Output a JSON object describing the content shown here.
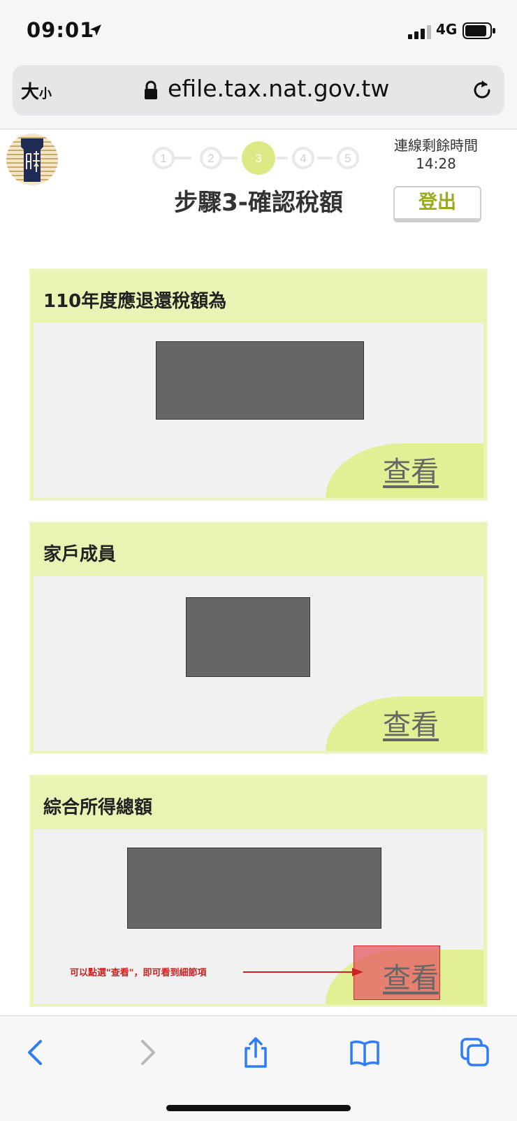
{
  "status_bar": {
    "time": "09:01",
    "network": "4G",
    "location_icon": "location-arrow-icon",
    "signal_icon": "signal-bars-icon",
    "battery_icon": "battery-icon"
  },
  "browser": {
    "text_size_label": "大",
    "text_size_small": "小",
    "url": "efile.tax.nat.gov.tw",
    "lock_icon": "lock-icon",
    "reload_icon": "reload-icon"
  },
  "header": {
    "steps": [
      "1",
      "2",
      "3",
      "4",
      "5"
    ],
    "active_step": 3,
    "title": "步驟3-確認稅額",
    "timer_label": "連線剩餘時間",
    "timer_value": "14:28",
    "logout_label": "登出"
  },
  "cards": [
    {
      "title": "110年度應退還稅額為",
      "view_label": "查看"
    },
    {
      "title": "家戶成員",
      "view_label": "查看"
    },
    {
      "title": "綜合所得總額",
      "view_label": "查看"
    }
  ],
  "annotation": {
    "text": "可以點選\"查看\"，即可看到細節項"
  },
  "toolbar": {
    "icons": [
      "back-icon",
      "forward-icon",
      "share-icon",
      "bookmarks-icon",
      "tabs-icon"
    ]
  },
  "colors": {
    "card_bg": "#e9f4b4",
    "accent": "#e3ef94",
    "step_active": "#dde985",
    "logout_text": "#9aaa1e",
    "annotation": "#cc2222"
  }
}
